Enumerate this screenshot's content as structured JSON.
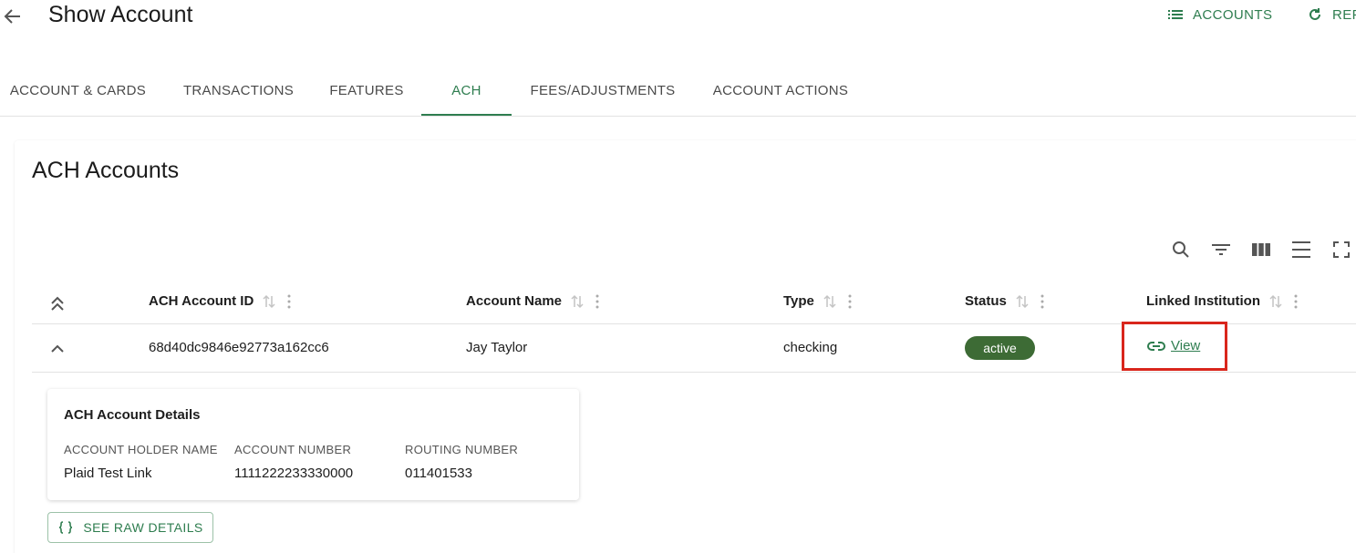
{
  "header": {
    "title": "Show Account",
    "actions": [
      {
        "label": "ACCOUNTS",
        "icon": "list-icon"
      },
      {
        "label": "REF",
        "icon": "refresh-icon"
      }
    ]
  },
  "tabs": [
    {
      "label": "ACCOUNT & CARDS"
    },
    {
      "label": "TRANSACTIONS"
    },
    {
      "label": "FEATURES"
    },
    {
      "label": "ACH",
      "active": true
    },
    {
      "label": "FEES/ADJUSTMENTS"
    },
    {
      "label": "ACCOUNT ACTIONS"
    }
  ],
  "card": {
    "title": "ACH Accounts",
    "toolbar": [
      "search-icon",
      "filter-icon",
      "columns-icon",
      "density-icon",
      "fullscreen-icon"
    ]
  },
  "table": {
    "columns": [
      "ACH Account ID",
      "Account Name",
      "Type",
      "Status",
      "Linked Institution"
    ],
    "rows": [
      {
        "ach_account_id": "68d40dc9846e92773a162cc6",
        "account_name": "Jay Taylor",
        "type": "checking",
        "status": "active",
        "linked_institution": "View"
      }
    ]
  },
  "details": {
    "title": "ACH Account Details",
    "fields": [
      {
        "label": "ACCOUNT HOLDER NAME",
        "value": "Plaid Test Link"
      },
      {
        "label": "ACCOUNT NUMBER",
        "value": "1111222233330000"
      },
      {
        "label": "ROUTING NUMBER",
        "value": "011401533"
      }
    ],
    "raw_button": "SEE RAW DETAILS"
  },
  "colors": {
    "accent": "#2e7d4f",
    "status_active": "#3d6b35",
    "highlight": "#d9261c"
  }
}
